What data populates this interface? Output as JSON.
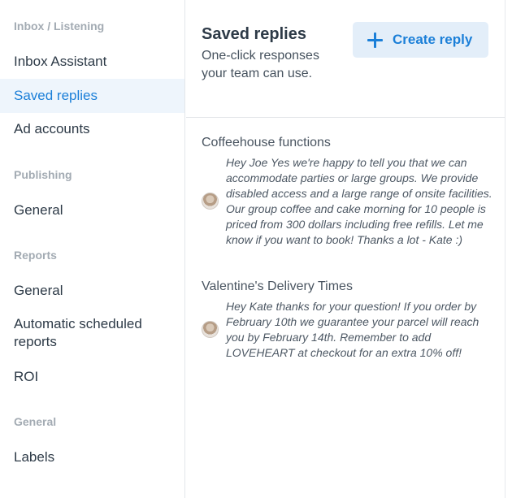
{
  "sidebar": {
    "sections": [
      {
        "title": "Inbox / Listening",
        "items": [
          "Inbox Assistant",
          "Saved replies",
          "Ad accounts"
        ]
      },
      {
        "title": "Publishing",
        "items": [
          "General"
        ]
      },
      {
        "title": "Reports",
        "items": [
          "General",
          "Automatic scheduled reports",
          "ROI"
        ]
      },
      {
        "title": "General",
        "items": [
          "Labels"
        ]
      }
    ],
    "active_item": "Saved replies"
  },
  "header": {
    "title": "Saved replies",
    "subtitle": "One-click responses your team can use.",
    "create_button_label": "Create reply"
  },
  "replies": [
    {
      "title": "Coffeehouse functions",
      "text": "Hey Joe Yes we're happy to tell you that we can accommodate parties or large groups. We provide disabled access and a large range of onsite facilities. Our group coffee and cake morning for 10 people is priced from 300 dollars including free refills. Let me know if you want to book! Thanks a lot - Kate :)"
    },
    {
      "title": "Valentine's Delivery Times",
      "text": "Hey Kate thanks for your question! If you order by February 10th we guarantee your parcel will reach you by February 14th. Remember to add LOVEHEART at checkout for an extra 10% off!"
    }
  ],
  "colors": {
    "accent": "#1b7fd8",
    "active_bg": "#eef5fc",
    "button_bg": "#e3eef9"
  }
}
